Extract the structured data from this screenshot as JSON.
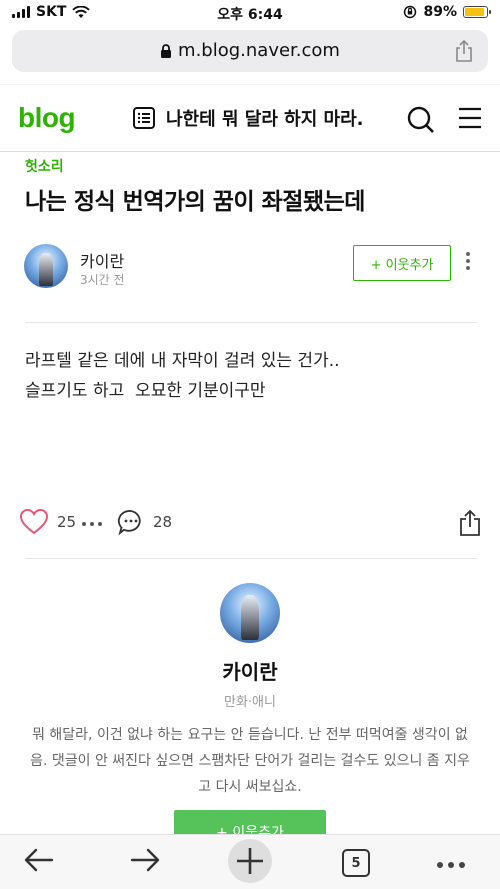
{
  "status_bar": {
    "carrier": "SKT",
    "time": "오후 6:44",
    "battery": "89%",
    "battery_level": 0.89
  },
  "browser": {
    "url": "m.blog.naver.com"
  },
  "blog_header": {
    "logo": "blog",
    "title": "나한테 뭐 달라 하지 마라."
  },
  "post": {
    "category": "헛소리",
    "title": "나는 정식 번역가의 꿈이 좌절됐는데",
    "author": "카이란",
    "time": "3시간 전",
    "follow_label": "+ 이웃추가",
    "body_lines": [
      "라프텔 같은 데에 내 자막이 걸려 있는 건가..",
      "슬프기도 하고  오묘한 기분이구만"
    ],
    "likes": "25",
    "comments": "28"
  },
  "profile": {
    "name": "카이란",
    "category": "만화·애니",
    "description": "뭐 해달라, 이건 없냐 하는 요구는 안 듣습니다. 난 전부 떠먹여줄 생각이 없음. 댓글이 안 써진다 싶으면 스팸차단 단어가 걸리는 걸수도 있으니 좀 지우고 다시 써보십쇼.",
    "follow_label": "+ 이웃추가"
  },
  "toolbar": {
    "tab_count": "5"
  },
  "colors": {
    "brand": "#2db400",
    "follow_fill": "#55c35a",
    "like_heart": "#e05a75"
  }
}
